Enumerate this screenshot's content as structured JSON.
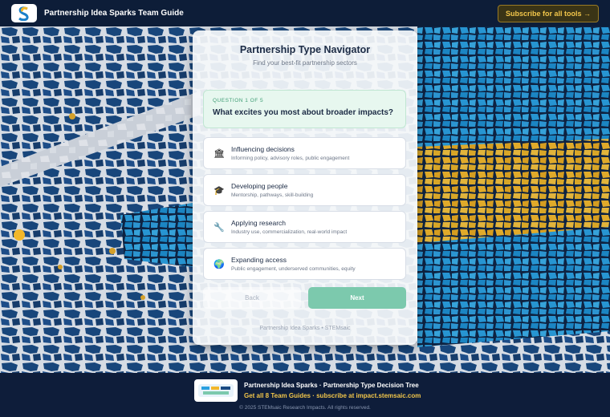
{
  "header": {
    "title": "Partnership Idea Sparks Team Guide",
    "subscribe_label": "Subscribe for all tools →"
  },
  "card": {
    "title": "Partnership Type Navigator",
    "subtitle": "Find your best-fit partnership sectors",
    "question": {
      "step": "QUESTION 1 OF 5",
      "text": "What excites you most about broader impacts?"
    },
    "options": [
      {
        "title": "Influencing decisions",
        "desc": "Informing policy, advisory roles, public engagement",
        "icon": "bank-icon",
        "glyph": "🏛"
      },
      {
        "title": "Developing people",
        "desc": "Mentorship, pathways, skill-building",
        "icon": "graduation-cap-icon",
        "glyph": "🎓"
      },
      {
        "title": "Applying research",
        "desc": "Industry use, commercialization, real-world impact",
        "icon": "wrench-icon",
        "glyph": "🔧"
      },
      {
        "title": "Expanding access",
        "desc": "Public engagement, underserved communities, equity",
        "icon": "globe-icon",
        "glyph": "🌍"
      }
    ],
    "back_label": "Back",
    "next_label": "Next",
    "footer": "Partnership Idea Sparks • STEMsaic"
  },
  "footer": {
    "title": "Partnership Idea Sparks · Partnership Type Decision Tree",
    "link": "Get all 8 Team Guides · subscribe at impact.stemsaic.com",
    "copyright": "© 2025 STEMsaic Research Impacts. All rights reserved."
  },
  "colors": {
    "navy": "#0d1d38",
    "accent_gold": "#f2c64a",
    "accent_green": "#7cc9ad",
    "mosaic_blue": "#1a4a82",
    "mosaic_sky": "#2aa0e0"
  }
}
